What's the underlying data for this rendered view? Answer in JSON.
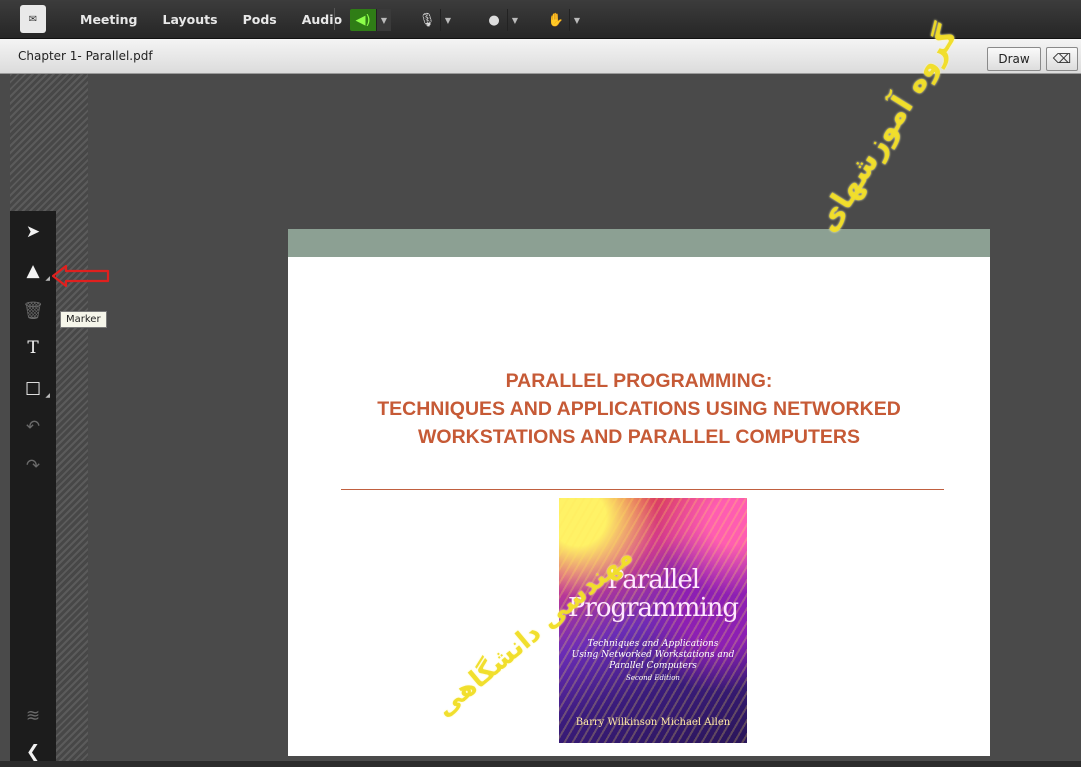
{
  "menu": {
    "items": [
      "Meeting",
      "Layouts",
      "Pods",
      "Audio"
    ]
  },
  "toolbar": {
    "speaker_icon": "speaker-on-icon",
    "mic_icon": "microphone-icon",
    "camera_icon": "webcam-icon",
    "raise_hand_icon": "raise-hand-icon",
    "accent_color": "#2f7d16"
  },
  "pod": {
    "title": "Chapter 1- Parallel.pdf",
    "draw_label": "Draw"
  },
  "tools": {
    "tooltip": "Marker"
  },
  "slide": {
    "title_lines": [
      "PARALLEL PROGRAMMING:",
      "TECHNIQUES AND APPLICATIONS USING NETWORKED",
      "WORKSTATIONS AND PARALLEL COMPUTERS"
    ],
    "title_color": "#c65a36",
    "cover": {
      "title1": "Parallel",
      "title2": "Programming",
      "subtitle1": "Techniques and Applications",
      "subtitle2": "Using Networked Workstations and",
      "subtitle3": "Parallel Computers",
      "edition": "Second Edition",
      "authors": "Barry Wilkinson   Michael Allen"
    }
  },
  "watermark": {
    "line1": "گروه آموزشهای",
    "line2": "مهندسی دانشگاهی"
  }
}
